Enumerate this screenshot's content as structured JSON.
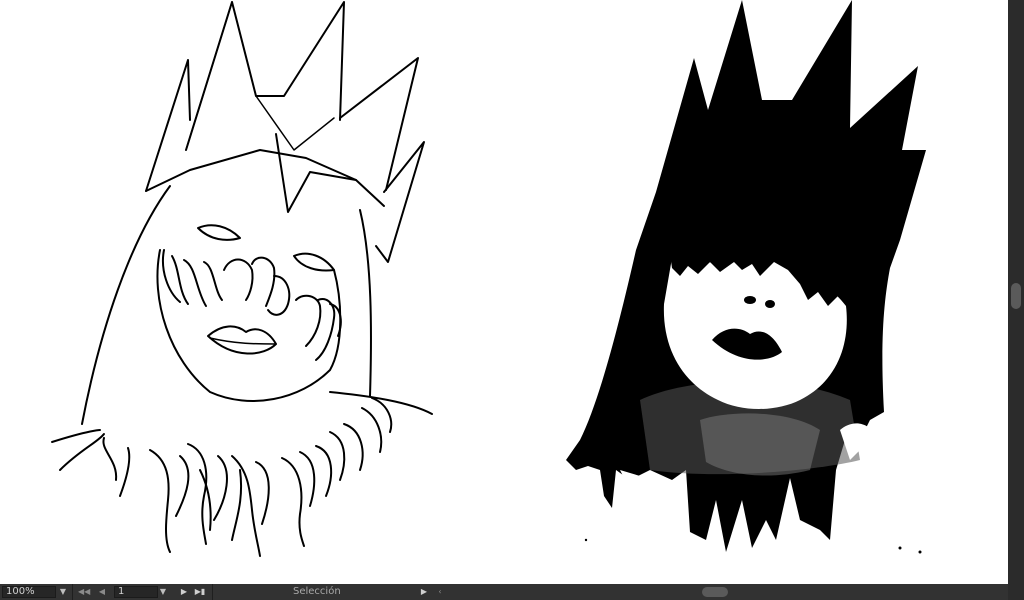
{
  "statusbar": {
    "zoom_value": "100%",
    "artboard_value": "1",
    "status_text": "Selección",
    "icons": {
      "zoom_dropdown": "chevron-down-icon",
      "first": "first-artboard-icon",
      "prev": "previous-artboard-icon",
      "artboard_dropdown": "chevron-down-icon",
      "next": "next-artboard-icon",
      "last": "last-artboard-icon",
      "status_menu": "status-menu-icon",
      "scroll_left": "scroll-left-icon"
    }
  },
  "canvas": {
    "artworks": [
      {
        "name": "line-art-drawing",
        "style": "outline"
      },
      {
        "name": "silhouette-drawing",
        "style": "filled"
      }
    ],
    "colors": {
      "background": "#ffffff",
      "ink": "#000000",
      "ui_dark": "#323232"
    }
  }
}
